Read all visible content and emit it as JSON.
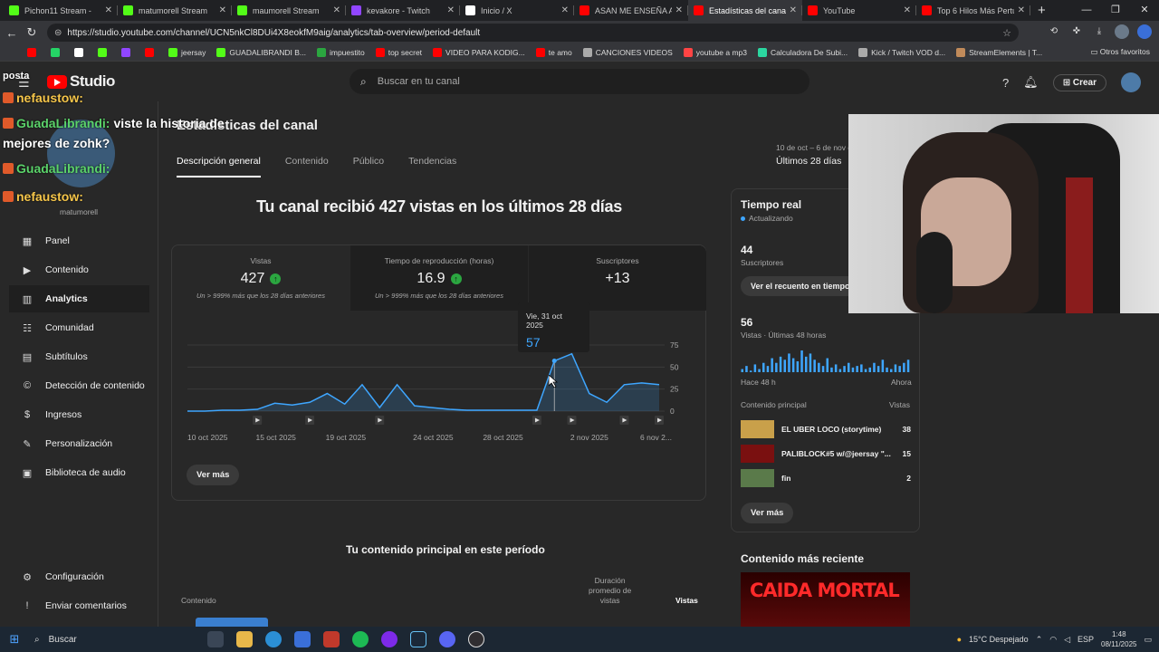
{
  "browser": {
    "tabs": [
      {
        "title": "Pichon11 Stream -",
        "color": "#53fc18"
      },
      {
        "title": "matumorell Stream",
        "color": "#53fc18"
      },
      {
        "title": "maumorell Stream",
        "color": "#53fc18"
      },
      {
        "title": "kevakore - Twitch",
        "color": "#9146ff"
      },
      {
        "title": "Inicio / X",
        "color": "#ffffff"
      },
      {
        "title": "ASAN ME ENSEÑA A HA",
        "color": "#ff0000"
      },
      {
        "title": "Estadísticas del canal - Y",
        "color": "#ff0000"
      },
      {
        "title": "YouTube",
        "color": "#ff0000"
      },
      {
        "title": "Top 6 Hilos Más Perturb",
        "color": "#ff0000"
      }
    ],
    "active_tab": 6,
    "url": "https://studio.youtube.com/channel/UCN5nkCl8DUi4X8eokfM9aig/analytics/tab-overview/period-default",
    "bookmarks": [
      {
        "label": "",
        "color": "#ff0000"
      },
      {
        "label": "",
        "color": "#25d366"
      },
      {
        "label": "",
        "color": "#ffffff"
      },
      {
        "label": "",
        "color": "#53fc18"
      },
      {
        "label": "",
        "color": "#9146ff"
      },
      {
        "label": "",
        "color": "#ff0000"
      },
      {
        "label": "jeersay",
        "color": "#53fc18"
      },
      {
        "label": "GUADALIBRANDI B...",
        "color": "#53fc18"
      },
      {
        "label": "impuestito",
        "color": "#2ba640"
      },
      {
        "label": "top secret",
        "color": "#ff0000"
      },
      {
        "label": "VIDEO PARA KODIG...",
        "color": "#ff0000"
      },
      {
        "label": "te amo",
        "color": "#ff0000"
      },
      {
        "label": "CANCIONES VIDEOS",
        "color": "#aaaaaa"
      },
      {
        "label": "youtube a mp3",
        "color": "#ff4444"
      },
      {
        "label": "Calculadora De Subi...",
        "color": "#2bd6a0"
      },
      {
        "label": "Kick / Twitch VOD d...",
        "color": "#aaaaaa"
      },
      {
        "label": "StreamElements | T...",
        "color": "#c08a5a"
      }
    ],
    "other_bookmarks": "Otros favoritos"
  },
  "studio": {
    "logo_text": "Studio",
    "search_placeholder": "Buscar en tu canal",
    "create_label": "Crear",
    "channel_name": "matumorell",
    "nav": [
      {
        "label": "Panel",
        "icon": "dashboard-icon",
        "glyph": "▦"
      },
      {
        "label": "Contenido",
        "icon": "content-icon",
        "glyph": "▶"
      },
      {
        "label": "Analytics",
        "icon": "analytics-icon",
        "glyph": "▥"
      },
      {
        "label": "Comunidad",
        "icon": "community-icon",
        "glyph": "☷"
      },
      {
        "label": "Subtítulos",
        "icon": "subtitles-icon",
        "glyph": "▤"
      },
      {
        "label": "Detección de contenido",
        "icon": "copyright-icon",
        "glyph": "©"
      },
      {
        "label": "Ingresos",
        "icon": "money-icon",
        "glyph": "$"
      },
      {
        "label": "Personalización",
        "icon": "customize-icon",
        "glyph": "✎"
      },
      {
        "label": "Biblioteca de audio",
        "icon": "audio-library-icon",
        "glyph": "▣"
      }
    ],
    "nav_bottom": [
      {
        "label": "Configuración",
        "icon": "settings-icon",
        "glyph": "⚙"
      },
      {
        "label": "Enviar comentarios",
        "icon": "feedback-icon",
        "glyph": "!"
      }
    ]
  },
  "analytics": {
    "page_title": "Estadísticas del canal",
    "tabs": [
      "Descripción general",
      "Contenido",
      "Público",
      "Tendencias"
    ],
    "date_range": "10 de oct – 6 de nov d",
    "date_period": "Últimos 28 días",
    "headline": "Tu canal recibió 427 vistas en los últimos 28 días",
    "metrics": [
      {
        "label": "Vistas",
        "value": "427",
        "sub": "Un > 999% más que los 28 días anteriores"
      },
      {
        "label": "Tiempo de reproducción (horas)",
        "value": "16.9",
        "sub": "Un > 999% más que los 28 días anteriores"
      },
      {
        "label": "Suscriptores",
        "value": "+13",
        "sub": ""
      }
    ],
    "tooltip": {
      "date": "Vie, 31 oct 2025",
      "value": "57"
    },
    "see_more": "Ver más",
    "top_content_title": "Tu contenido principal en este período",
    "table_headers": {
      "content": "Contenido",
      "duration": "Duración\npromedio de\nvistas",
      "views": "Vistas"
    }
  },
  "chart_data": {
    "type": "area",
    "x": [
      "10 oct 2025",
      "11 oct",
      "12 oct",
      "13 oct",
      "14 oct",
      "15 oct 2025",
      "16 oct",
      "17 oct",
      "18 oct",
      "19 oct 2025",
      "20 oct",
      "21 oct",
      "22 oct",
      "23 oct",
      "24 oct 2025",
      "25 oct",
      "26 oct",
      "27 oct",
      "28 oct 2025",
      "29 oct",
      "30 oct",
      "31 oct 2025",
      "1 nov",
      "2 nov 2025",
      "3 nov",
      "4 nov",
      "5 nov",
      "6 nov 2025"
    ],
    "values": [
      0,
      0,
      1,
      1,
      2,
      9,
      7,
      10,
      20,
      8,
      30,
      4,
      30,
      6,
      4,
      2,
      1,
      1,
      1,
      1,
      1,
      57,
      65,
      20,
      10,
      30,
      32,
      30
    ],
    "tick_labels": [
      "10 oct 2025",
      "15 oct 2025",
      "19 oct 2025",
      "24 oct 2025",
      "28 oct 2025",
      "2 nov 2025",
      "6 nov 2..."
    ],
    "tick_index": [
      0,
      5,
      9,
      14,
      18,
      23,
      27
    ],
    "yticks": [
      0,
      25,
      50,
      75
    ],
    "ylim": [
      0,
      75
    ],
    "marker_index": [
      4,
      7,
      11,
      20,
      22,
      25,
      27
    ],
    "highlight_index": 21,
    "color": "#3ea6ff"
  },
  "realtime": {
    "title": "Tiempo real",
    "status": "Actualizando",
    "subs_count": "44",
    "subs_label": "Suscriptores",
    "button": "Ver el recuento en tiempo r",
    "views_count": "56",
    "views_label": "Vistas · Últimas 48 horas",
    "bars": [
      2,
      4,
      1,
      5,
      2,
      6,
      4,
      9,
      6,
      10,
      8,
      12,
      9,
      7,
      14,
      10,
      12,
      8,
      6,
      4,
      9,
      3,
      5,
      2,
      4,
      6,
      3,
      4,
      5,
      2,
      3,
      6,
      4,
      8,
      3,
      2,
      5,
      4,
      6,
      8
    ],
    "axis_left": "Hace 48 h",
    "axis_right": "Ahora",
    "list_header": "Contenido principal",
    "list_header_right": "Vistas",
    "items": [
      {
        "title": "EL UBER LOCO (storytime)",
        "views": "38"
      },
      {
        "title": "PALIBLOCK#5 w/@jeersay \"...",
        "views": "15"
      },
      {
        "title": "fin",
        "views": "2"
      }
    ],
    "see_more": "Ver más"
  },
  "recent": {
    "title": "Contenido más reciente",
    "thumb_text": "CAIDA MORTAL"
  },
  "overlay_chat": [
    {
      "user": "posta",
      "msg": ""
    },
    {
      "user": "nefaustow:",
      "msg": ""
    },
    {
      "user": "GuadaLibrandi:",
      "msg": "viste la historia de"
    },
    {
      "user": "",
      "msg": "mejores de zohk?"
    },
    {
      "user": "GuadaLibrandi:",
      "msg": ""
    },
    {
      "user": "nefaustow:",
      "msg": ""
    }
  ],
  "taskbar": {
    "search": "Buscar",
    "weather": "15°C  Despejado",
    "lang": "ESP",
    "time": "1:48",
    "date": "08/11/2025"
  }
}
